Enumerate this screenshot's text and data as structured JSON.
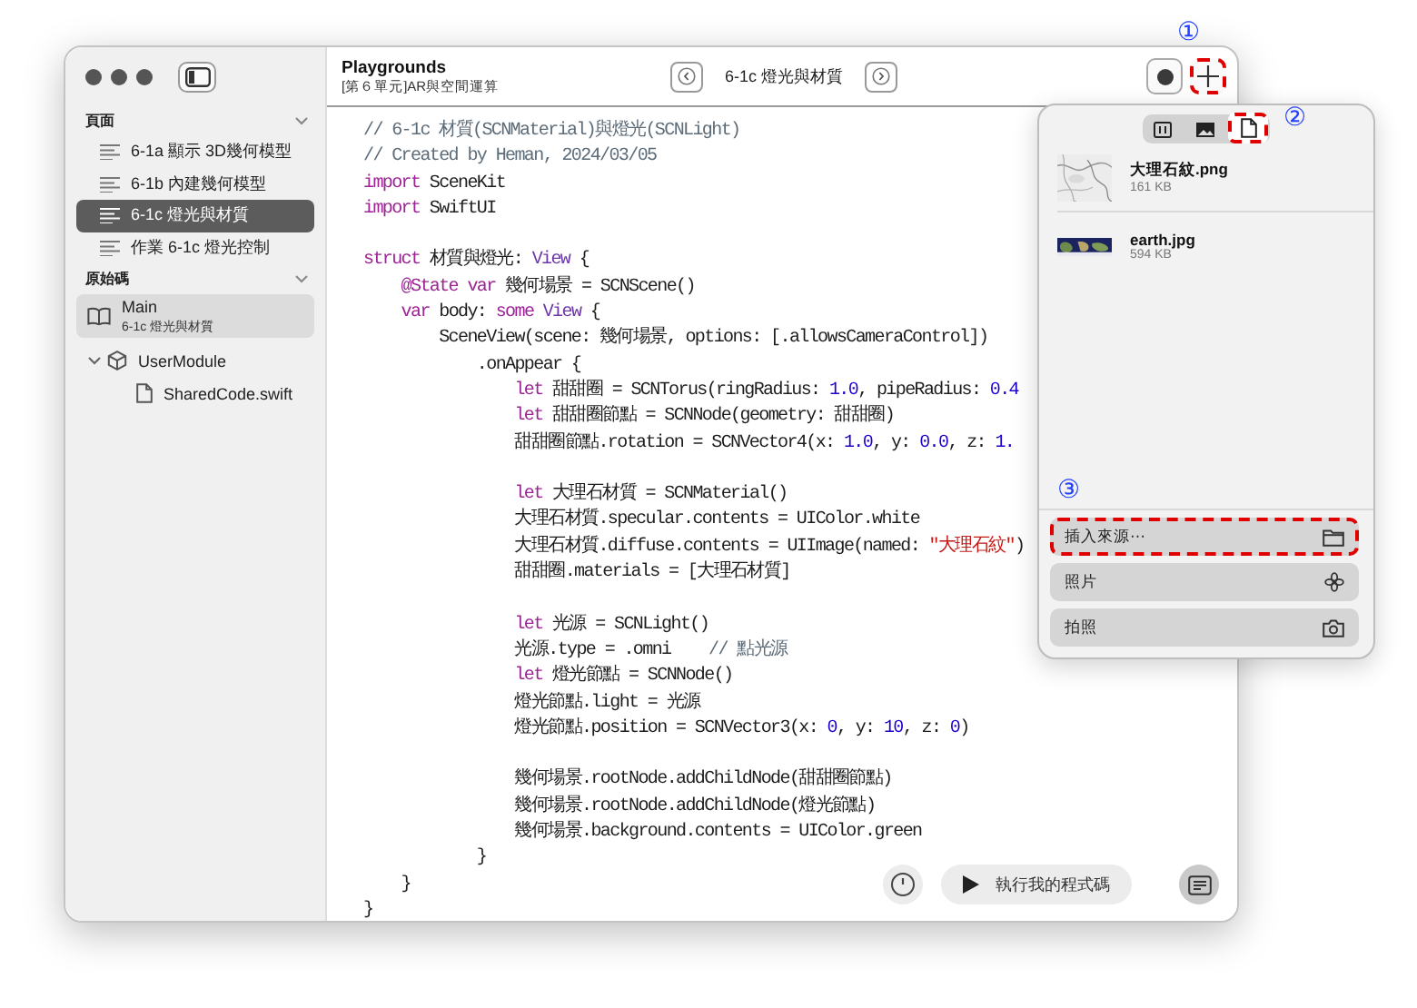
{
  "sidebar": {
    "sections": [
      {
        "kind": "pages",
        "title": "頁面",
        "expanded": true,
        "items": [
          {
            "kind": "page",
            "label": "6-1a 顯示 3D幾何模型",
            "selected": false
          },
          {
            "kind": "page",
            "label": "6-1b 內建幾何模型",
            "selected": false
          },
          {
            "kind": "page",
            "label": "6-1c 燈光與材質",
            "selected": true
          },
          {
            "kind": "page",
            "label": "作業 6-1c 燈光控制",
            "selected": false
          }
        ]
      },
      {
        "kind": "sources",
        "title": "原始碼",
        "expanded": true,
        "items": [
          {
            "kind": "book",
            "label": "Main",
            "subtitle": "6-1c 燈光與材質",
            "selected": true
          },
          {
            "kind": "module",
            "label": "UserModule",
            "expanded": true,
            "selected": false,
            "children": [
              {
                "kind": "file",
                "label": "SharedCode.swift",
                "selected": false
              }
            ]
          }
        ]
      }
    ]
  },
  "header": {
    "title": "Playgrounds",
    "subtitle": "[第６單元]AR與空間運算",
    "page_title": "6-1c 燈光與材質"
  },
  "toolbar_buttons": [
    {
      "kind": "record",
      "highlighted": false
    },
    {
      "kind": "add",
      "highlighted": true,
      "callout": "①"
    }
  ],
  "code": [
    {
      "kind": "code",
      "tokens": [
        {
          "kind": "comment",
          "text": "// 6-1c 材質(SCNMaterial)與燈光(SCNLight)"
        }
      ]
    },
    {
      "kind": "code",
      "tokens": [
        {
          "kind": "comment",
          "text": "// Created by Heman, 2024/03/05"
        }
      ]
    },
    {
      "kind": "code",
      "tokens": [
        {
          "kind": "keyword",
          "text": "import"
        },
        {
          "kind": "plain",
          "text": " SceneKit"
        }
      ]
    },
    {
      "kind": "code",
      "tokens": [
        {
          "kind": "keyword",
          "text": "import"
        },
        {
          "kind": "plain",
          "text": " SwiftUI"
        }
      ]
    },
    {
      "kind": "blank"
    },
    {
      "kind": "code",
      "tokens": [
        {
          "kind": "keyword",
          "text": "struct"
        },
        {
          "kind": "plain",
          "text": " 材質與燈光: "
        },
        {
          "kind": "type",
          "text": "View"
        },
        {
          "kind": "plain",
          "text": " {"
        }
      ]
    },
    {
      "kind": "code",
      "tokens": [
        {
          "kind": "keyword",
          "text": "    @State var"
        },
        {
          "kind": "plain",
          "text": " 幾何場景 = SCNScene()"
        }
      ]
    },
    {
      "kind": "code",
      "tokens": [
        {
          "kind": "keyword",
          "text": "    var"
        },
        {
          "kind": "plain",
          "text": " body: "
        },
        {
          "kind": "keyword",
          "text": "some"
        },
        {
          "kind": "type",
          "text": " View"
        },
        {
          "kind": "plain",
          "text": " {"
        }
      ]
    },
    {
      "kind": "code",
      "tokens": [
        {
          "kind": "plain",
          "text": "        SceneView(scene: 幾何場景, options: [.allowsCameraControl])"
        }
      ]
    },
    {
      "kind": "code",
      "tokens": [
        {
          "kind": "plain",
          "text": "            .onAppear {"
        }
      ]
    },
    {
      "kind": "code",
      "tokens": [
        {
          "kind": "keyword",
          "text": "                let"
        },
        {
          "kind": "plain",
          "text": " 甜甜圈 = SCNTorus(ringRadius: "
        },
        {
          "kind": "number",
          "text": "1.0"
        },
        {
          "kind": "plain",
          "text": ", pipeRadius: "
        },
        {
          "kind": "number",
          "text": "0.4"
        }
      ]
    },
    {
      "kind": "code",
      "tokens": [
        {
          "kind": "keyword",
          "text": "                let"
        },
        {
          "kind": "plain",
          "text": " 甜甜圈節點 = SCNNode(geometry: 甜甜圈)"
        }
      ]
    },
    {
      "kind": "code",
      "tokens": [
        {
          "kind": "plain",
          "text": "                甜甜圈節點.rotation = SCNVector4(x: "
        },
        {
          "kind": "number",
          "text": "1.0"
        },
        {
          "kind": "plain",
          "text": ", y: "
        },
        {
          "kind": "number",
          "text": "0.0"
        },
        {
          "kind": "plain",
          "text": ", z: "
        },
        {
          "kind": "number",
          "text": "1."
        }
      ]
    },
    {
      "kind": "blank"
    },
    {
      "kind": "code",
      "tokens": [
        {
          "kind": "keyword",
          "text": "                let"
        },
        {
          "kind": "plain",
          "text": " 大理石材質 = SCNMaterial()"
        }
      ]
    },
    {
      "kind": "code",
      "tokens": [
        {
          "kind": "plain",
          "text": "                大理石材質.specular.contents = UIColor.white"
        }
      ]
    },
    {
      "kind": "code",
      "tokens": [
        {
          "kind": "plain",
          "text": "                大理石材質.diffuse.contents = UIImage(named: "
        },
        {
          "kind": "string",
          "text": "\"大理石紋\""
        },
        {
          "kind": "plain",
          "text": ")"
        }
      ]
    },
    {
      "kind": "code",
      "tokens": [
        {
          "kind": "plain",
          "text": "                甜甜圈.materials = [大理石材質]"
        }
      ]
    },
    {
      "kind": "blank"
    },
    {
      "kind": "code",
      "tokens": [
        {
          "kind": "keyword",
          "text": "                let"
        },
        {
          "kind": "plain",
          "text": " 光源 = SCNLight()"
        }
      ]
    },
    {
      "kind": "code",
      "tokens": [
        {
          "kind": "plain",
          "text": "                光源.type = .omni    "
        },
        {
          "kind": "comment",
          "text": "// 點光源"
        }
      ]
    },
    {
      "kind": "code",
      "tokens": [
        {
          "kind": "keyword",
          "text": "                let"
        },
        {
          "kind": "plain",
          "text": " 燈光節點 = SCNNode()"
        }
      ]
    },
    {
      "kind": "code",
      "tokens": [
        {
          "kind": "plain",
          "text": "                燈光節點.light = 光源"
        }
      ]
    },
    {
      "kind": "code",
      "tokens": [
        {
          "kind": "plain",
          "text": "                燈光節點.position = SCNVector3(x: "
        },
        {
          "kind": "number",
          "text": "0"
        },
        {
          "kind": "plain",
          "text": ", y: "
        },
        {
          "kind": "number",
          "text": "10"
        },
        {
          "kind": "plain",
          "text": ", z: "
        },
        {
          "kind": "number",
          "text": "0"
        },
        {
          "kind": "plain",
          "text": ")"
        }
      ]
    },
    {
      "kind": "blank"
    },
    {
      "kind": "code",
      "tokens": [
        {
          "kind": "plain",
          "text": "                幾何場景.rootNode.addChildNode(甜甜圈節點)"
        }
      ]
    },
    {
      "kind": "code",
      "tokens": [
        {
          "kind": "plain",
          "text": "                幾何場景.rootNode.addChildNode(燈光節點)"
        }
      ]
    },
    {
      "kind": "code",
      "tokens": [
        {
          "kind": "plain",
          "text": "                幾何場景.background.contents = UIColor.green"
        }
      ]
    },
    {
      "kind": "code",
      "tokens": [
        {
          "kind": "plain",
          "text": "            }"
        }
      ]
    },
    {
      "kind": "code",
      "tokens": [
        {
          "kind": "plain",
          "text": "    }"
        }
      ]
    },
    {
      "kind": "code",
      "tokens": [
        {
          "kind": "plain",
          "text": "}"
        }
      ]
    }
  ],
  "popover": {
    "tabs": [
      {
        "kind": "snippets",
        "selected": false,
        "highlighted": false
      },
      {
        "kind": "media",
        "selected": false,
        "highlighted": false
      },
      {
        "kind": "files",
        "selected": true,
        "highlighted": true,
        "callout": "②"
      }
    ],
    "files": [
      {
        "kind": "picture",
        "name": "大理石紋.png",
        "size": "161 KB"
      },
      {
        "kind": "picture",
        "name": "earth.jpg",
        "size": "594 KB"
      }
    ],
    "callout": "③",
    "actions": [
      {
        "kind": "folder",
        "label": "插入來源⋯",
        "highlighted": true
      },
      {
        "label": "照片",
        "highlighted": false
      },
      {
        "kind": "camera",
        "label": "拍照",
        "highlighted": false
      }
    ]
  },
  "bottom_bar": {
    "run_label": "執行我的程式碼"
  }
}
